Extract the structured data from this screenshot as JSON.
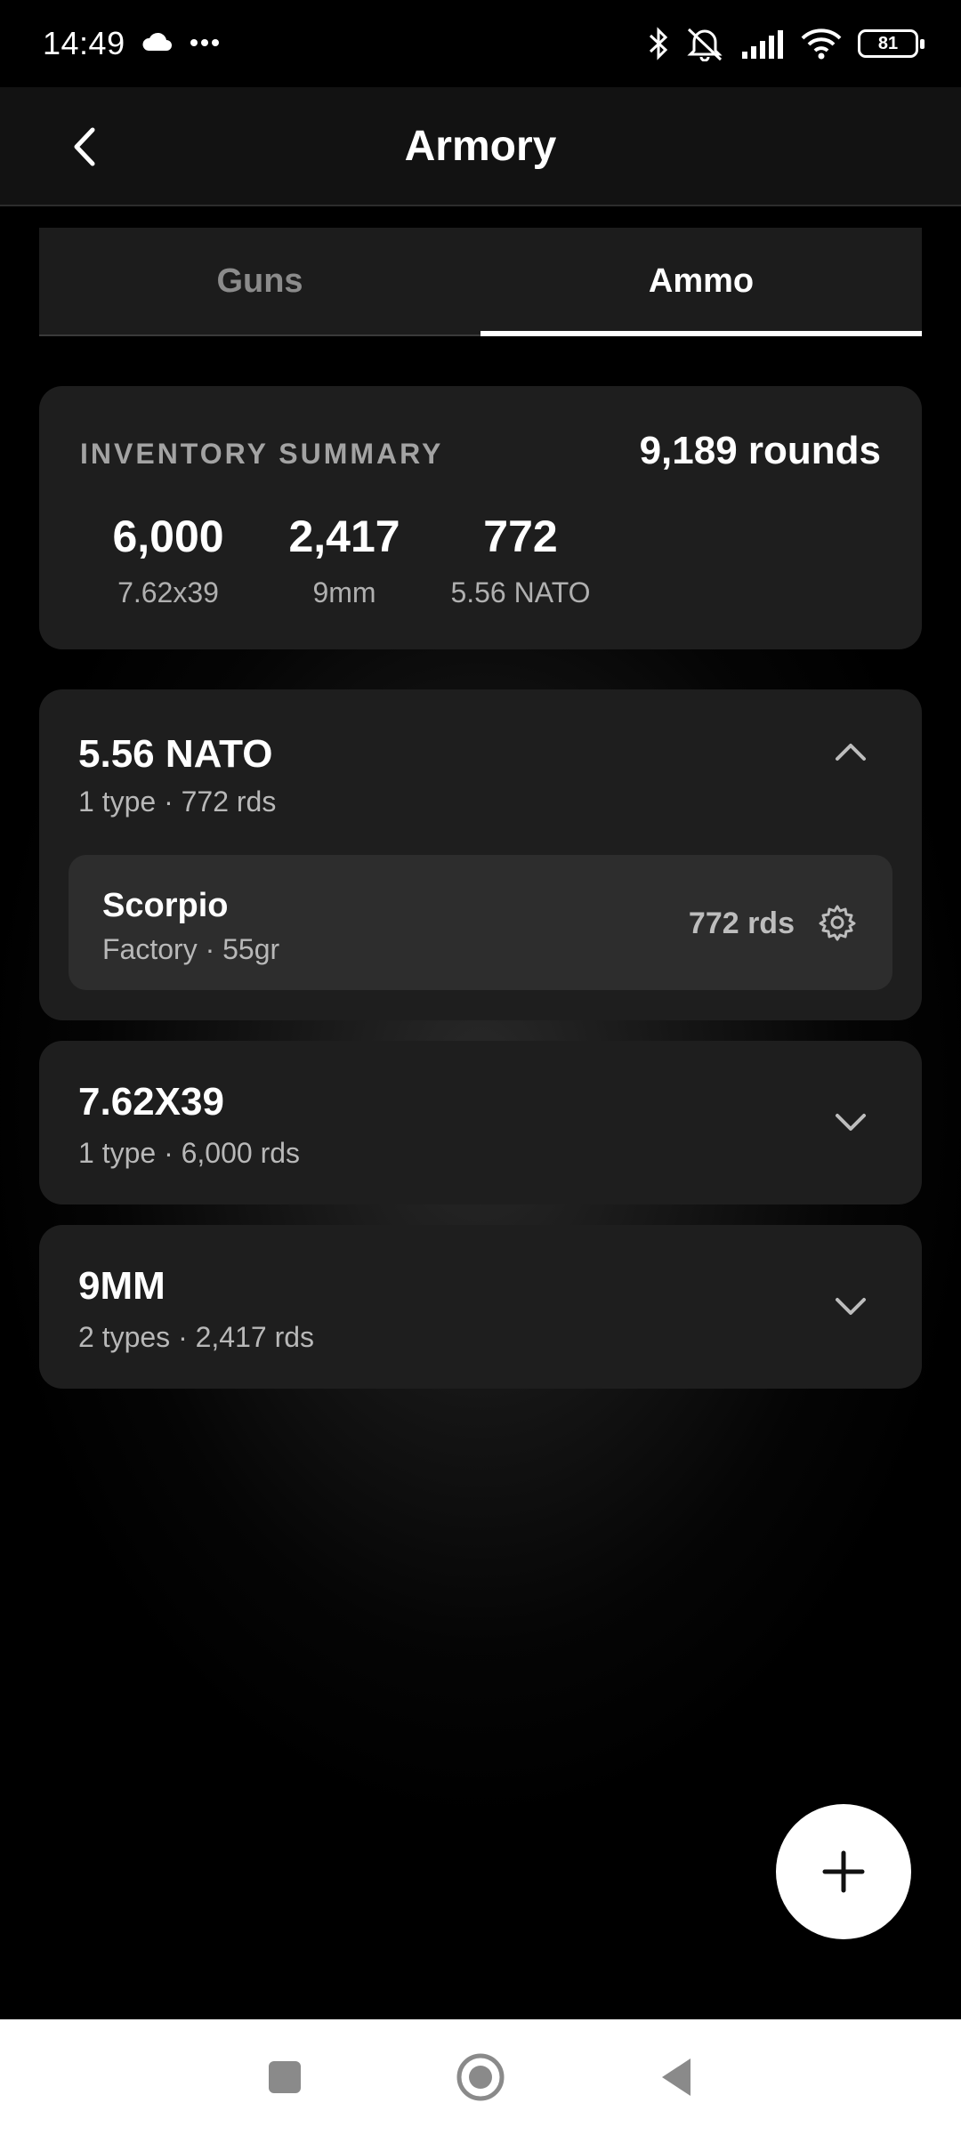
{
  "status_bar": {
    "time": "14:49",
    "battery": "81",
    "icons": [
      "cloud-icon",
      "more-dots-icon",
      "bluetooth-icon",
      "mute-icon",
      "signal-icon",
      "wifi-icon",
      "battery-icon"
    ]
  },
  "header": {
    "title": "Armory",
    "back_icon": "back-arrow-icon"
  },
  "tabs": [
    {
      "label": "Guns",
      "active": false
    },
    {
      "label": "Ammo",
      "active": true
    }
  ],
  "summary": {
    "label": "INVENTORY SUMMARY",
    "total": "9,189 rounds",
    "stats": [
      {
        "value": "6,000",
        "label": "7.62x39"
      },
      {
        "value": "2,417",
        "label": "9mm"
      },
      {
        "value": "772",
        "label": "5.56 NATO"
      }
    ]
  },
  "groups": [
    {
      "title": "5.56 NATO",
      "subtitle": "1 type · 772 rds",
      "expanded": true,
      "items": [
        {
          "name": "Scorpio",
          "subtitle": "Factory · 55gr",
          "count": "772 rds"
        }
      ]
    },
    {
      "title": "7.62X39",
      "subtitle": "1 type · 6,000 rds",
      "expanded": false
    },
    {
      "title": "9MM",
      "subtitle": "2 types · 2,417 rds",
      "expanded": false
    }
  ],
  "fab": {
    "icon": "plus-icon"
  },
  "nav_bar": {
    "icons": [
      "recents-square-icon",
      "home-circle-icon",
      "back-triangle-icon"
    ]
  },
  "colors": {
    "background": "#000000",
    "card": "#1e1e1e",
    "item_card": "#2d2d2d",
    "accent": "#ffffff",
    "muted_text": "#b8b8b8"
  }
}
